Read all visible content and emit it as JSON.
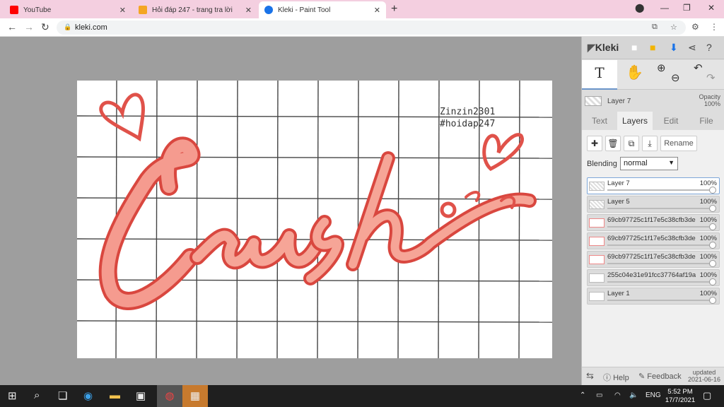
{
  "browser": {
    "tabs": [
      {
        "title": "YouTube",
        "favicon_color": "#ff0000"
      },
      {
        "title": "Hỏi đáp 247 - trang tra lời",
        "favicon_color": "#f4a623"
      },
      {
        "title": "Kleki - Paint Tool",
        "favicon_color": "#1a73e8"
      }
    ],
    "url": "kleki.com"
  },
  "canvas": {
    "signature_line1": "Zinzin2301",
    "signature_line2": "#hoidap247"
  },
  "panel": {
    "brand": "Kleki",
    "current_layer": "Layer 7",
    "opacity_label": "Opacity",
    "opacity_value": "100%",
    "tabs": [
      "Text",
      "Layers",
      "Edit",
      "File"
    ],
    "rename_label": "Rename",
    "blending_label": "Blending",
    "blending_value": "normal",
    "layers": [
      {
        "name": "Layer 7",
        "opacity": "100%"
      },
      {
        "name": "Layer 5",
        "opacity": "100%"
      },
      {
        "name": "69cb97725c1f17e5c38cfb3de",
        "opacity": "100%"
      },
      {
        "name": "69cb97725c1f17e5c38cfb3de",
        "opacity": "100%"
      },
      {
        "name": "69cb97725c1f17e5c38cfb3de",
        "opacity": "100%"
      },
      {
        "name": "255c04e31e91fcc37764af19a",
        "opacity": "100%"
      },
      {
        "name": "Layer 1",
        "opacity": "100%"
      }
    ],
    "help_label": "Help",
    "feedback_label": "Feedback",
    "updated_label": "updated",
    "updated_date": "2021-06-16"
  },
  "taskbar": {
    "time": "5:52 PM",
    "date": "17/7/2021",
    "lang": "ENG"
  },
  "colors": {
    "accent": "#e8655a",
    "tabbar": "#f4cfe0",
    "workspace": "#9e9e9e"
  }
}
